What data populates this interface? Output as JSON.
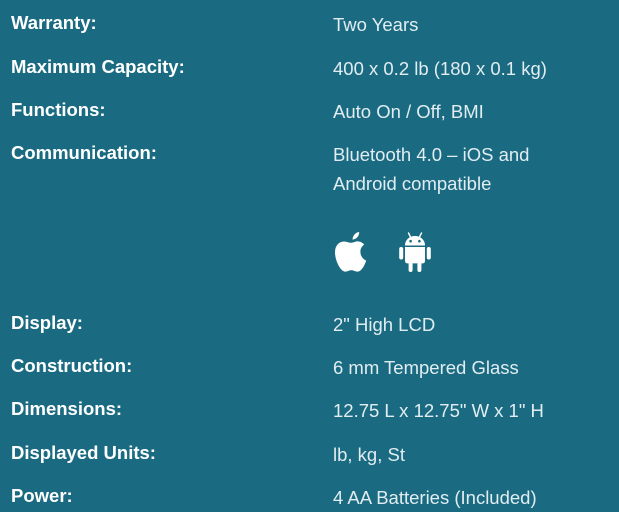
{
  "specs": [
    {
      "label": "Warranty:",
      "value": "Two Years"
    },
    {
      "label": "Maximum Capacity:",
      "value": "400 x 0.2 lb (180 x 0.1 kg)"
    },
    {
      "label": "Functions:",
      "value": "Auto On / Off, BMI"
    },
    {
      "label": "Communication:",
      "value": "Bluetooth 4.0 – iOS and\nAndroid compatible"
    },
    {
      "label": "Display:",
      "value": "2\" High LCD"
    },
    {
      "label": "Construction:",
      "value": "6 mm Tempered Glass"
    },
    {
      "label": "Dimensions:",
      "value": "12.75 L x 12.75\" W x 1\" H"
    },
    {
      "label": "Displayed Units:",
      "value": "lb, kg, St"
    },
    {
      "label": "Power:",
      "value": "4 AA Batteries (Included)"
    }
  ],
  "icons": [
    "apple-icon",
    "android-icon"
  ],
  "colors": {
    "background": "#1a6b82",
    "label": "#ffffff",
    "value": "#e2edf1"
  }
}
